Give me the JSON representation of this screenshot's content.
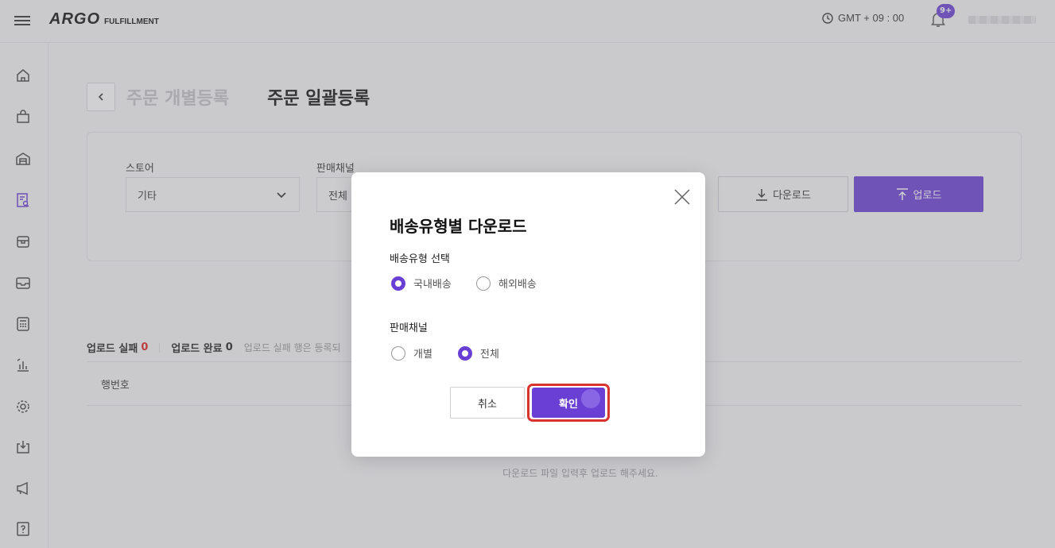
{
  "header": {
    "logo_mark": "ARGO",
    "logo_sub": "FULFILLMENT",
    "timezone": "GMT + 09 : 00",
    "notification_badge": "9+"
  },
  "sidebar": {
    "icons": [
      "home-icon",
      "bag-icon",
      "warehouse-icon",
      "order-search-icon",
      "store-icon",
      "inbox-icon",
      "calculator-icon",
      "chart-icon",
      "settings-icon",
      "download-icon",
      "megaphone-icon",
      "help-icon"
    ],
    "active_index": 3
  },
  "page": {
    "tab_individual": "주문 개별등록",
    "tab_bulk": "주문 일괄등록",
    "store_label": "스토어",
    "store_value": "기타",
    "channel_label": "판매채널",
    "channel_value": "전체",
    "download_btn": "다운로드",
    "upload_btn": "업로드"
  },
  "stats": {
    "fail_label": "업로드 실패",
    "fail_count": "0",
    "ok_label": "업로드 완료",
    "ok_count": "0",
    "note": "업로드 실패 행은 등록되"
  },
  "table": {
    "col_row_number": "행번호",
    "empty_line1": "",
    "empty_line2": "다운로드 파일 입력후 업로드 해주세요."
  },
  "modal": {
    "title": "배송유형별 다운로드",
    "delivery_label": "배송유형 선택",
    "delivery_options": [
      {
        "label": "국내배송",
        "selected": true
      },
      {
        "label": "해외배송",
        "selected": false
      }
    ],
    "channel_label": "판매채널",
    "channel_options": [
      {
        "label": "개별",
        "selected": false
      },
      {
        "label": "전체",
        "selected": true
      }
    ],
    "cancel": "취소",
    "confirm": "확인"
  },
  "colors": {
    "accent": "#6a3fd4",
    "highlight": "#d8332f",
    "fail": "#e02020"
  }
}
